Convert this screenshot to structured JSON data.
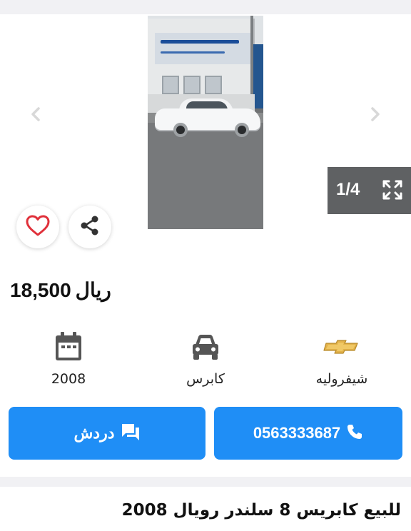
{
  "gallery": {
    "counter": "1/4",
    "icons": {
      "prev": "chevron-left-icon",
      "next": "chevron-right-icon",
      "expand": "expand-icon",
      "favorite": "heart-icon",
      "share": "share-icon"
    }
  },
  "listing": {
    "price_amount": "18,500",
    "price_currency": "ريال",
    "specs": [
      {
        "icon": "calendar-icon",
        "label": "2008"
      },
      {
        "icon": "car-icon",
        "label": "كابرس"
      },
      {
        "icon": "chevrolet-logo",
        "label": "شيفروليه"
      }
    ],
    "title": "للبيع كابريس 8 سلندر رويال 2008"
  },
  "actions": {
    "chat_label": "دردش",
    "call_label": "0563333687"
  },
  "colors": {
    "accent": "#1f8ef6",
    "heart": "#e0303a",
    "counter_bg": "#5f6163",
    "divider": "#f1f1f4",
    "chevrolet_gold": "#e2b24a"
  }
}
